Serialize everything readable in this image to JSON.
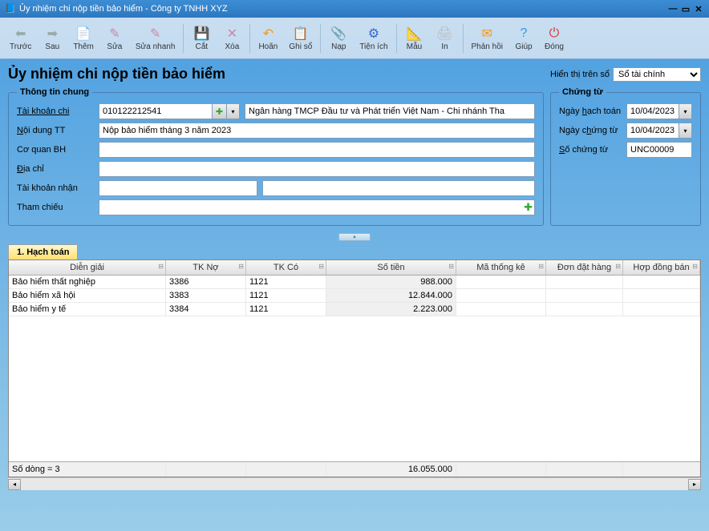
{
  "window": {
    "title": "Ủy nhiệm chi nộp tiền bảo hiểm - Công ty TNHH XYZ"
  },
  "toolbar": [
    {
      "id": "prev",
      "label": "Trước",
      "icon": "⬅",
      "color": "#9aa"
    },
    {
      "id": "next",
      "label": "Sau",
      "icon": "➡",
      "color": "#9aa"
    },
    {
      "id": "add",
      "label": "Thêm",
      "icon": "📄",
      "color": "#c8a"
    },
    {
      "id": "edit",
      "label": "Sửa",
      "icon": "✎",
      "color": "#c8a"
    },
    {
      "id": "quickedit",
      "label": "Sửa nhanh",
      "icon": "✎",
      "color": "#c8a"
    },
    {
      "id": "cut",
      "label": "Cắt",
      "icon": "💾",
      "color": "#36c"
    },
    {
      "id": "delete",
      "label": "Xóa",
      "icon": "✕",
      "color": "#c8a"
    },
    {
      "id": "undo",
      "label": "Hoãn",
      "icon": "↶",
      "color": "#f90"
    },
    {
      "id": "post",
      "label": "Ghi sổ",
      "icon": "📋",
      "color": "#bbb"
    },
    {
      "id": "load",
      "label": "Nạp",
      "icon": "📎",
      "color": "#3a5"
    },
    {
      "id": "util",
      "label": "Tiện ích",
      "icon": "⚙",
      "color": "#36c"
    },
    {
      "id": "template",
      "label": "Mẫu",
      "icon": "📐",
      "color": "#f90"
    },
    {
      "id": "print",
      "label": "In",
      "icon": "🖨",
      "color": "#bbb"
    },
    {
      "id": "feedback",
      "label": "Phản hồi",
      "icon": "✉",
      "color": "#f90"
    },
    {
      "id": "help",
      "label": "Giúp",
      "icon": "?",
      "color": "#39d"
    },
    {
      "id": "close",
      "label": "Đóng",
      "icon": "⏻",
      "color": "#d33"
    }
  ],
  "page": {
    "title": "Ủy nhiệm chi nộp tiền bảo hiểm",
    "display_label": "Hiển thị trên sổ",
    "display_value": "Sổ tài chính"
  },
  "general": {
    "legend": "Thông tin chung",
    "account_label": "Tài khoản chi",
    "account_value": "010122212541",
    "bank_value": "Ngân hàng TMCP Đầu tư và Phát triển Việt Nam - Chi nhánh Tha",
    "content_label": "Nội dung TT",
    "content_value": "Nộp bảo hiểm tháng 3 năm 2023",
    "agency_label": "Cơ quan BH",
    "agency_value": "",
    "address_label": "Địa chỉ",
    "address_value": "",
    "recv_account_label": "Tài khoản nhận",
    "recv_account_value": "",
    "recv_bank_value": "",
    "ref_label": "Tham chiếu"
  },
  "voucher": {
    "legend": "Chứng từ",
    "acc_date_label": "Ngày hạch toán",
    "acc_date_value": "10/04/2023",
    "doc_date_label": "Ngày chứng từ",
    "doc_date_value": "10/04/2023",
    "doc_no_label": "Số chứng từ",
    "doc_no_value": "UNC00009"
  },
  "tab": {
    "label": "1. Hạch toán"
  },
  "grid": {
    "columns": [
      "Diễn giải",
      "TK Nợ",
      "TK Có",
      "Số tiền",
      "Mã thống kê",
      "Đơn đặt hàng",
      "Hợp đồng bán"
    ],
    "rows": [
      {
        "desc": "Bảo hiểm thất nghiệp",
        "debit": "3386",
        "credit": "1121",
        "amount": "988.000",
        "stat": "",
        "order": "",
        "contract": ""
      },
      {
        "desc": "Bảo hiểm xã hội",
        "debit": "3383",
        "credit": "1121",
        "amount": "12.844.000",
        "stat": "",
        "order": "",
        "contract": ""
      },
      {
        "desc": "Bảo hiểm y tế",
        "debit": "3384",
        "credit": "1121",
        "amount": "2.223.000",
        "stat": "",
        "order": "",
        "contract": ""
      }
    ],
    "footer_rows": "Số dòng = 3",
    "footer_total": "16.055.000"
  }
}
